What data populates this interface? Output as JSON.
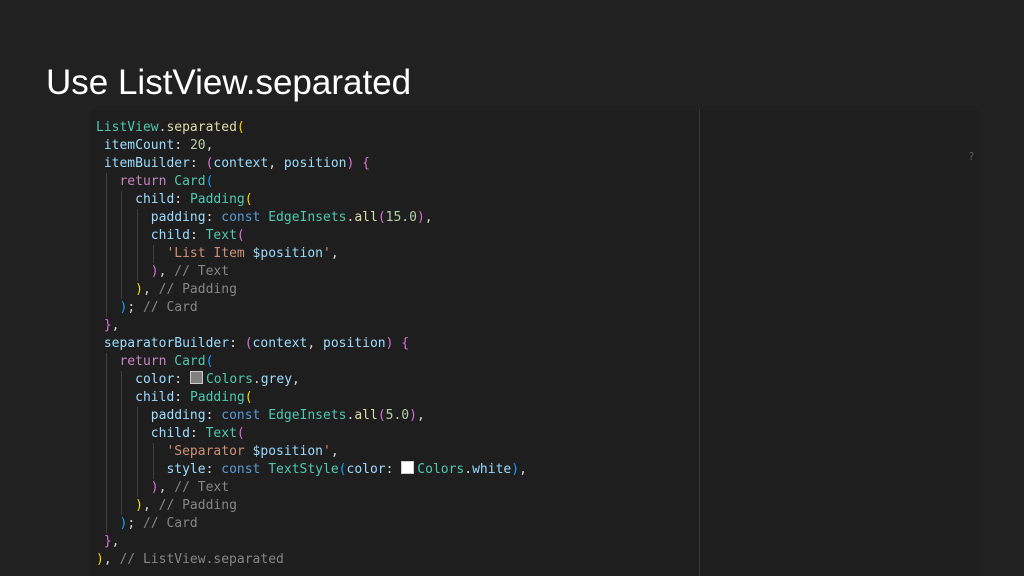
{
  "slide": {
    "title": "Use ListView.separated"
  },
  "editor": {
    "marker": "?",
    "lines": [
      {
        "guides": [],
        "tokens": [
          [
            "t-class",
            "ListView"
          ],
          [
            "t-plain",
            "."
          ],
          [
            "t-fn",
            "separated"
          ],
          [
            "t-p1",
            "("
          ]
        ]
      },
      {
        "guides": [],
        "tokens": [
          [
            "t-plain",
            " "
          ],
          [
            "t-prop",
            "itemCount"
          ],
          [
            "t-plain",
            ": "
          ],
          [
            "t-num",
            "20"
          ],
          [
            "t-plain",
            ","
          ]
        ]
      },
      {
        "guides": [],
        "tokens": [
          [
            "t-plain",
            " "
          ],
          [
            "t-prop",
            "itemBuilder"
          ],
          [
            "t-plain",
            ": "
          ],
          [
            "t-p2",
            "("
          ],
          [
            "t-var",
            "context"
          ],
          [
            "t-plain",
            ", "
          ],
          [
            "t-var",
            "position"
          ],
          [
            "t-p2",
            ")"
          ],
          [
            "t-plain",
            " "
          ],
          [
            "t-p2",
            "{"
          ]
        ]
      },
      {
        "guides": [
          1
        ],
        "tokens": [
          [
            "t-plain",
            "   "
          ],
          [
            "t-kw",
            "return"
          ],
          [
            "t-plain",
            " "
          ],
          [
            "t-class",
            "Card"
          ],
          [
            "t-p3",
            "("
          ]
        ]
      },
      {
        "guides": [
          1,
          3
        ],
        "tokens": [
          [
            "t-plain",
            "     "
          ],
          [
            "t-prop",
            "child"
          ],
          [
            "t-plain",
            ": "
          ],
          [
            "t-class",
            "Padding"
          ],
          [
            "t-p1",
            "("
          ]
        ]
      },
      {
        "guides": [
          1,
          3,
          5
        ],
        "tokens": [
          [
            "t-plain",
            "       "
          ],
          [
            "t-prop",
            "padding"
          ],
          [
            "t-plain",
            ": "
          ],
          [
            "t-const",
            "const"
          ],
          [
            "t-plain",
            " "
          ],
          [
            "t-class",
            "EdgeInsets"
          ],
          [
            "t-plain",
            "."
          ],
          [
            "t-fn",
            "all"
          ],
          [
            "t-p2",
            "("
          ],
          [
            "t-num",
            "15.0"
          ],
          [
            "t-p2",
            ")"
          ],
          [
            "t-plain",
            ","
          ]
        ]
      },
      {
        "guides": [
          1,
          3,
          5
        ],
        "tokens": [
          [
            "t-plain",
            "       "
          ],
          [
            "t-prop",
            "child"
          ],
          [
            "t-plain",
            ": "
          ],
          [
            "t-class",
            "Text"
          ],
          [
            "t-p2",
            "("
          ]
        ]
      },
      {
        "guides": [
          1,
          3,
          5,
          7
        ],
        "tokens": [
          [
            "t-plain",
            "         "
          ],
          [
            "t-str",
            "'List Item "
          ],
          [
            "t-var",
            "$position"
          ],
          [
            "t-str",
            "'"
          ],
          [
            "t-plain",
            ","
          ]
        ]
      },
      {
        "guides": [
          1,
          3,
          5
        ],
        "tokens": [
          [
            "t-plain",
            "       "
          ],
          [
            "t-p2",
            ")"
          ],
          [
            "t-plain",
            ", "
          ],
          [
            "t-cmt",
            "// Text"
          ]
        ]
      },
      {
        "guides": [
          1,
          3
        ],
        "tokens": [
          [
            "t-plain",
            "     "
          ],
          [
            "t-p1",
            ")"
          ],
          [
            "t-plain",
            ", "
          ],
          [
            "t-cmt",
            "// Padding"
          ]
        ]
      },
      {
        "guides": [
          1
        ],
        "tokens": [
          [
            "t-plain",
            "   "
          ],
          [
            "t-p3",
            ")"
          ],
          [
            "t-plain",
            "; "
          ],
          [
            "t-cmt",
            "// Card"
          ]
        ]
      },
      {
        "guides": [],
        "tokens": [
          [
            "t-plain",
            " "
          ],
          [
            "t-p2",
            "}"
          ],
          [
            "t-plain",
            ","
          ]
        ]
      },
      {
        "guides": [],
        "tokens": [
          [
            "t-plain",
            " "
          ],
          [
            "t-prop",
            "separatorBuilder"
          ],
          [
            "t-plain",
            ": "
          ],
          [
            "t-p2",
            "("
          ],
          [
            "t-var",
            "context"
          ],
          [
            "t-plain",
            ", "
          ],
          [
            "t-var",
            "position"
          ],
          [
            "t-p2",
            ")"
          ],
          [
            "t-plain",
            " "
          ],
          [
            "t-p2",
            "{"
          ]
        ]
      },
      {
        "guides": [
          1
        ],
        "tokens": [
          [
            "t-plain",
            "   "
          ],
          [
            "t-kw",
            "return"
          ],
          [
            "t-plain",
            " "
          ],
          [
            "t-class",
            "Card"
          ],
          [
            "t-p3",
            "("
          ]
        ]
      },
      {
        "guides": [
          1,
          3
        ],
        "tokens": [
          [
            "t-plain",
            "     "
          ],
          [
            "t-prop",
            "color"
          ],
          [
            "t-plain",
            ": "
          ],
          [
            "swatch",
            "#808080"
          ],
          [
            "t-class",
            "Colors"
          ],
          [
            "t-plain",
            "."
          ],
          [
            "t-prop",
            "grey"
          ],
          [
            "t-plain",
            ","
          ]
        ]
      },
      {
        "guides": [
          1,
          3
        ],
        "tokens": [
          [
            "t-plain",
            "     "
          ],
          [
            "t-prop",
            "child"
          ],
          [
            "t-plain",
            ": "
          ],
          [
            "t-class",
            "Padding"
          ],
          [
            "t-p1",
            "("
          ]
        ]
      },
      {
        "guides": [
          1,
          3,
          5
        ],
        "tokens": [
          [
            "t-plain",
            "       "
          ],
          [
            "t-prop",
            "padding"
          ],
          [
            "t-plain",
            ": "
          ],
          [
            "t-const",
            "const"
          ],
          [
            "t-plain",
            " "
          ],
          [
            "t-class",
            "EdgeInsets"
          ],
          [
            "t-plain",
            "."
          ],
          [
            "t-fn",
            "all"
          ],
          [
            "t-p2",
            "("
          ],
          [
            "t-num",
            "5.0"
          ],
          [
            "t-p2",
            ")"
          ],
          [
            "t-plain",
            ","
          ]
        ]
      },
      {
        "guides": [
          1,
          3,
          5
        ],
        "tokens": [
          [
            "t-plain",
            "       "
          ],
          [
            "t-prop",
            "child"
          ],
          [
            "t-plain",
            ": "
          ],
          [
            "t-class",
            "Text"
          ],
          [
            "t-p2",
            "("
          ]
        ]
      },
      {
        "guides": [
          1,
          3,
          5,
          7
        ],
        "tokens": [
          [
            "t-plain",
            "         "
          ],
          [
            "t-str",
            "'Separator "
          ],
          [
            "t-var",
            "$position"
          ],
          [
            "t-str",
            "'"
          ],
          [
            "t-plain",
            ","
          ]
        ]
      },
      {
        "guides": [
          1,
          3,
          5,
          7
        ],
        "tokens": [
          [
            "t-plain",
            "         "
          ],
          [
            "t-prop",
            "style"
          ],
          [
            "t-plain",
            ": "
          ],
          [
            "t-const",
            "const"
          ],
          [
            "t-plain",
            " "
          ],
          [
            "t-class",
            "TextStyle"
          ],
          [
            "t-p3",
            "("
          ],
          [
            "t-prop",
            "color"
          ],
          [
            "t-plain",
            ": "
          ],
          [
            "swatch",
            "#ffffff"
          ],
          [
            "t-class",
            "Colors"
          ],
          [
            "t-plain",
            "."
          ],
          [
            "t-prop",
            "white"
          ],
          [
            "t-p3",
            ")"
          ],
          [
            "t-plain",
            ","
          ]
        ]
      },
      {
        "guides": [
          1,
          3,
          5
        ],
        "tokens": [
          [
            "t-plain",
            "       "
          ],
          [
            "t-p2",
            ")"
          ],
          [
            "t-plain",
            ", "
          ],
          [
            "t-cmt",
            "// Text"
          ]
        ]
      },
      {
        "guides": [
          1,
          3
        ],
        "tokens": [
          [
            "t-plain",
            "     "
          ],
          [
            "t-p1",
            ")"
          ],
          [
            "t-plain",
            ", "
          ],
          [
            "t-cmt",
            "// Padding"
          ]
        ]
      },
      {
        "guides": [
          1
        ],
        "tokens": [
          [
            "t-plain",
            "   "
          ],
          [
            "t-p3",
            ")"
          ],
          [
            "t-plain",
            "; "
          ],
          [
            "t-cmt",
            "// Card"
          ]
        ]
      },
      {
        "guides": [],
        "tokens": [
          [
            "t-plain",
            " "
          ],
          [
            "t-p2",
            "}"
          ],
          [
            "t-plain",
            ","
          ]
        ]
      },
      {
        "guides": [],
        "tokens": [
          [
            "t-p1",
            ")"
          ],
          [
            "t-plain",
            ", "
          ],
          [
            "t-cmt",
            "// ListView.separated"
          ]
        ]
      }
    ]
  }
}
